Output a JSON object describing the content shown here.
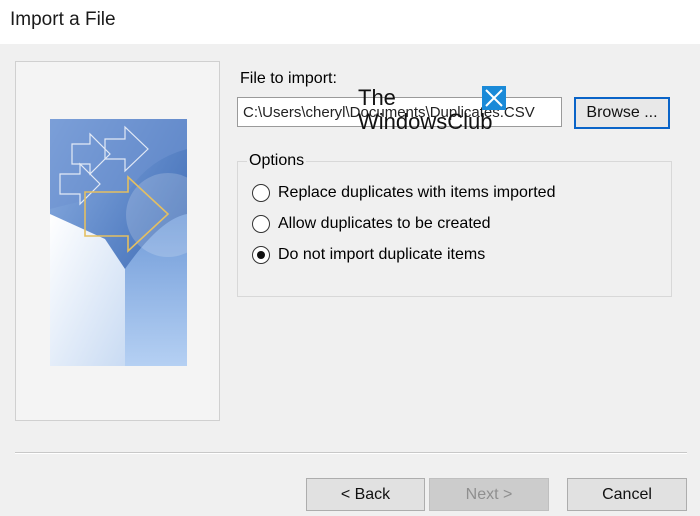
{
  "window": {
    "title": "Import a File"
  },
  "file_section": {
    "label": "File to import:",
    "path_value": "C:\\Users\\cheryl\\Documents\\Duplicates.CSV",
    "browse_label": "Browse ..."
  },
  "watermark": {
    "line1": "The",
    "line2": "WindowsClub",
    "logo_icon": "windowsclub-logo-icon"
  },
  "options": {
    "legend": "Options",
    "items": [
      {
        "label": "Replace duplicates with items imported",
        "selected": false
      },
      {
        "label": "Allow duplicates to be created",
        "selected": false
      },
      {
        "label": "Do not import duplicate items",
        "selected": true
      }
    ]
  },
  "footer": {
    "back_label": "< Back",
    "next_label": "Next >",
    "cancel_label": "Cancel",
    "next_enabled": false
  },
  "colors": {
    "accent": "#0a64c8",
    "art_dark_blue": "#3f6bb1",
    "art_light_blue": "#a9c8ee",
    "arrow_gold": "#e3bf62"
  }
}
